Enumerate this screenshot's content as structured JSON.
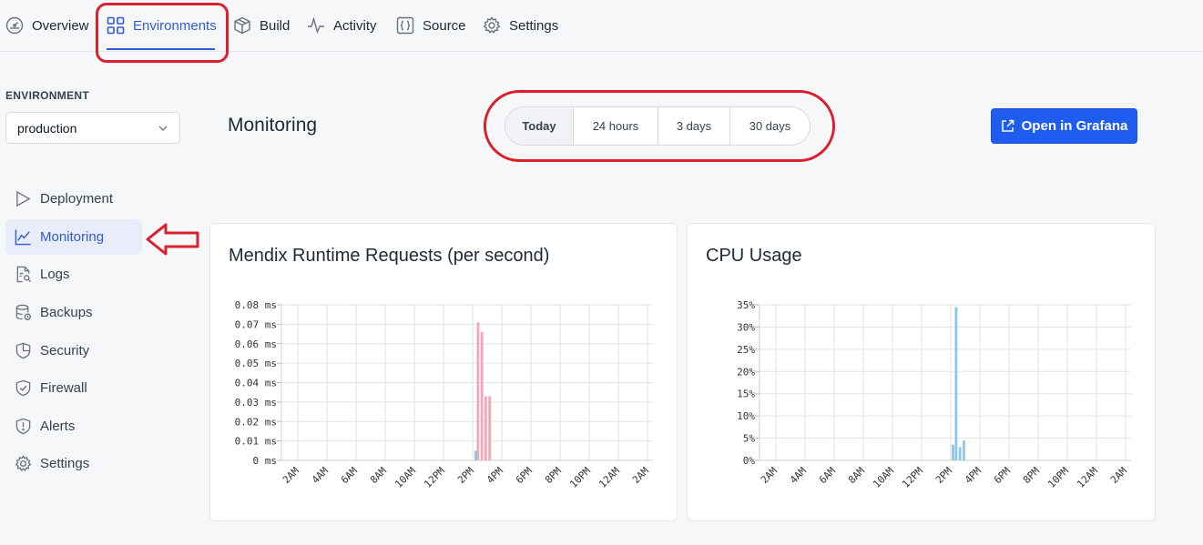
{
  "nav": {
    "tabs": [
      {
        "label": "Overview",
        "icon": "dashboard-icon"
      },
      {
        "label": "Environments",
        "icon": "grid-icon",
        "active": true
      },
      {
        "label": "Build",
        "icon": "box-icon"
      },
      {
        "label": "Activity",
        "icon": "activity-icon"
      },
      {
        "label": "Source",
        "icon": "braces-icon"
      },
      {
        "label": "Settings",
        "icon": "gear-icon"
      }
    ]
  },
  "sidebar": {
    "environment_label": "ENVIRONMENT",
    "environment_value": "production",
    "items": [
      {
        "label": "Deployment",
        "icon": "play-icon"
      },
      {
        "label": "Monitoring",
        "icon": "line-chart-icon",
        "active": true
      },
      {
        "label": "Logs",
        "icon": "file-search-icon"
      },
      {
        "label": "Backups",
        "icon": "database-icon"
      },
      {
        "label": "Security",
        "icon": "shield-icon"
      },
      {
        "label": "Firewall",
        "icon": "shield-check-icon"
      },
      {
        "label": "Alerts",
        "icon": "alert-shield-icon"
      },
      {
        "label": "Settings",
        "icon": "gear-icon"
      }
    ]
  },
  "main": {
    "title": "Monitoring",
    "ranges": [
      "Today",
      "24 hours",
      "3 days",
      "30 days"
    ],
    "selected_range": "Today",
    "grafana_label": "Open in Grafana"
  },
  "colors": {
    "accent": "#2f5bd3",
    "primary_button": "#1f5cf0",
    "annotation": "#d9202c",
    "series_pink": "#f4a6b8",
    "series_blue": "#8ec5ea"
  },
  "chart_data": [
    {
      "type": "bar",
      "title": "Mendix Runtime Requests (per second)",
      "y_ticks": [
        "0 ms",
        "0.01 ms",
        "0.02 ms",
        "0.03 ms",
        "0.04 ms",
        "0.05 ms",
        "0.06 ms",
        "0.07 ms",
        "0.08 ms"
      ],
      "ylim": [
        0,
        0.08
      ],
      "x_ticks": [
        "2AM",
        "4AM",
        "6AM",
        "8AM",
        "10AM",
        "12PM",
        "2PM",
        "4PM",
        "6PM",
        "8PM",
        "10PM",
        "12AM",
        "2AM"
      ],
      "xlim_hours": [
        0,
        24
      ],
      "grid": true,
      "series": [
        {
          "color": "#f4a6b8",
          "points": [
            {
              "x": 12.7,
              "y": 0.071
            },
            {
              "x": 12.95,
              "y": 0.066
            },
            {
              "x": 13.2,
              "y": 0.033
            },
            {
              "x": 13.45,
              "y": 0.033
            }
          ]
        },
        {
          "color": "#8ec5ea",
          "points": [
            {
              "x": 12.55,
              "y": 0.005
            }
          ]
        }
      ]
    },
    {
      "type": "bar",
      "title": "CPU Usage",
      "y_ticks": [
        "0%",
        "5%",
        "10%",
        "15%",
        "20%",
        "25%",
        "30%",
        "35%"
      ],
      "ylim": [
        0,
        35
      ],
      "x_ticks": [
        "2AM",
        "4AM",
        "6AM",
        "8AM",
        "10AM",
        "12PM",
        "2PM",
        "4PM",
        "6PM",
        "8PM",
        "10PM",
        "12AM",
        "2AM"
      ],
      "xlim_hours": [
        0,
        24
      ],
      "grid": true,
      "series": [
        {
          "color": "#8ec5ea",
          "points": [
            {
              "x": 12.5,
              "y": 3.5
            },
            {
              "x": 12.7,
              "y": 34.5
            },
            {
              "x": 12.95,
              "y": 3.0
            },
            {
              "x": 13.2,
              "y": 4.5
            }
          ]
        }
      ]
    }
  ]
}
